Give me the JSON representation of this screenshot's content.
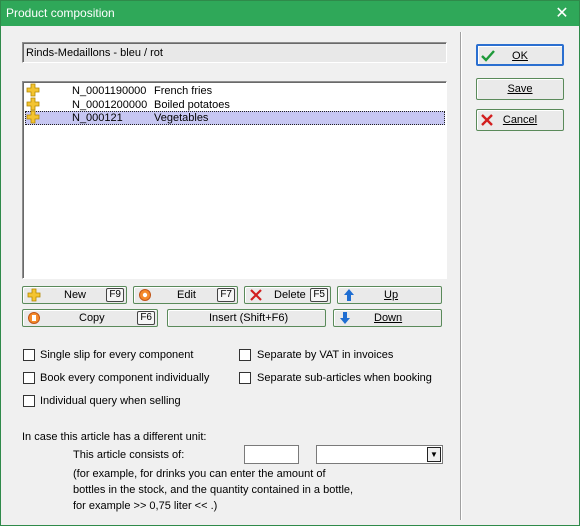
{
  "window": {
    "title": "Product composition",
    "close_glyph": "✕"
  },
  "article_name": "Rinds-Medaillons - bleu / rot",
  "components": [
    {
      "code": "N_0001190000",
      "name": "French fries",
      "icon": "plus-icon",
      "selected": false
    },
    {
      "code": "N_0001200000",
      "name": "Boiled potatoes",
      "icon": "plus-icon",
      "selected": false
    },
    {
      "code": "N_000121",
      "name": "Vegetables",
      "icon": "plus-icon",
      "selected": true
    }
  ],
  "toolbar": {
    "new_label": "New",
    "new_key": "F9",
    "edit_label": "Edit",
    "edit_key": "F7",
    "delete_label": "Delete",
    "delete_key": "F5",
    "up_label": "Up",
    "copy_label": "Copy",
    "copy_key": "F6",
    "insert_label": "Insert (Shift+F6)",
    "down_label": "Down"
  },
  "options": {
    "single_slip": "Single slip for every component",
    "separate_vat": "Separate by VAT in invoices",
    "book_individually": "Book every component individually",
    "separate_sub": "Separate sub-articles when booking",
    "individual_query": "Individual query when selling"
  },
  "unit": {
    "heading": "In case this article has a different unit:",
    "consists_label": "This article consists of:",
    "quantity_value": "",
    "unit_value": "",
    "hint_1": "(for example, for drinks you can enter the amount of",
    "hint_2": "bottles in the stock, and the quantity contained in a bottle,",
    "hint_3": "for example >> 0,75 liter << .)"
  },
  "buttons": {
    "ok": "OK",
    "save": "Save",
    "cancel": "Cancel"
  },
  "colors": {
    "titlebar": "#2fa859",
    "selection": "#c7c7f2",
    "accent_green": "#1e9a3a",
    "accent_red": "#d21f1f",
    "accent_blue": "#1f6ed2"
  }
}
